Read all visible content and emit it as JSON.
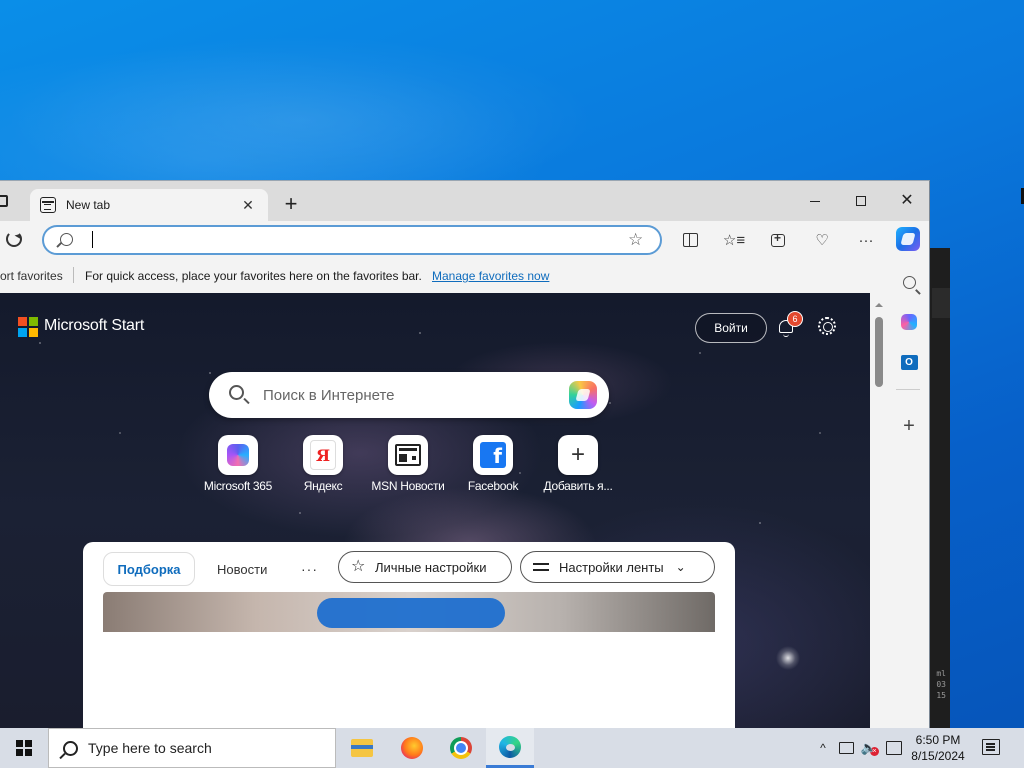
{
  "browser": {
    "tab": {
      "title": "New tab",
      "close": "✕"
    },
    "new_tab": "+",
    "window": {
      "close": "✕"
    },
    "address": {
      "value": "",
      "placeholder": ""
    },
    "toolbar": {
      "more": "···"
    },
    "favorites_bar": {
      "partial_label": "ort favorites",
      "message": "For quick access, place your favorites here on the favorites bar.",
      "link": "Manage favorites now"
    },
    "sidebar": {
      "add": "+"
    }
  },
  "page": {
    "brand": "Microsoft Start",
    "brand_colors": [
      "#f25022",
      "#7fba00",
      "#00a4ef",
      "#ffb900"
    ],
    "signin": "Войти",
    "notifications_count": "6",
    "search": {
      "placeholder": "Поиск в Интернете"
    },
    "quick_links": [
      {
        "label": "Microsoft 365",
        "icon": "microsoft-365-icon"
      },
      {
        "label": "Яндекс",
        "icon": "yandex-icon",
        "glyph": "Я"
      },
      {
        "label": "MSN Новости",
        "icon": "msn-news-icon"
      },
      {
        "label": "Facebook",
        "icon": "facebook-icon",
        "glyph": "f"
      },
      {
        "label": "Добавить я...",
        "icon": "add-icon",
        "glyph": "+"
      }
    ],
    "feed": {
      "tabs": [
        "Подборка",
        "Новости"
      ],
      "more": "···",
      "personal_settings": "Личные настройки",
      "feed_settings": "Настройки ленты",
      "star_glyph": "☆",
      "chevron_glyph": "⌄"
    }
  },
  "background": {
    "side_text": "ml\n03\n15"
  },
  "taskbar": {
    "search_placeholder": "Type here to search",
    "apps": [
      "file-explorer",
      "firefox",
      "chrome",
      "edge"
    ],
    "active_app": "edge",
    "tray": {
      "chevron": "^",
      "volume": "🔈"
    },
    "clock": {
      "time": "6:50 PM",
      "date": "8/15/2024"
    }
  }
}
